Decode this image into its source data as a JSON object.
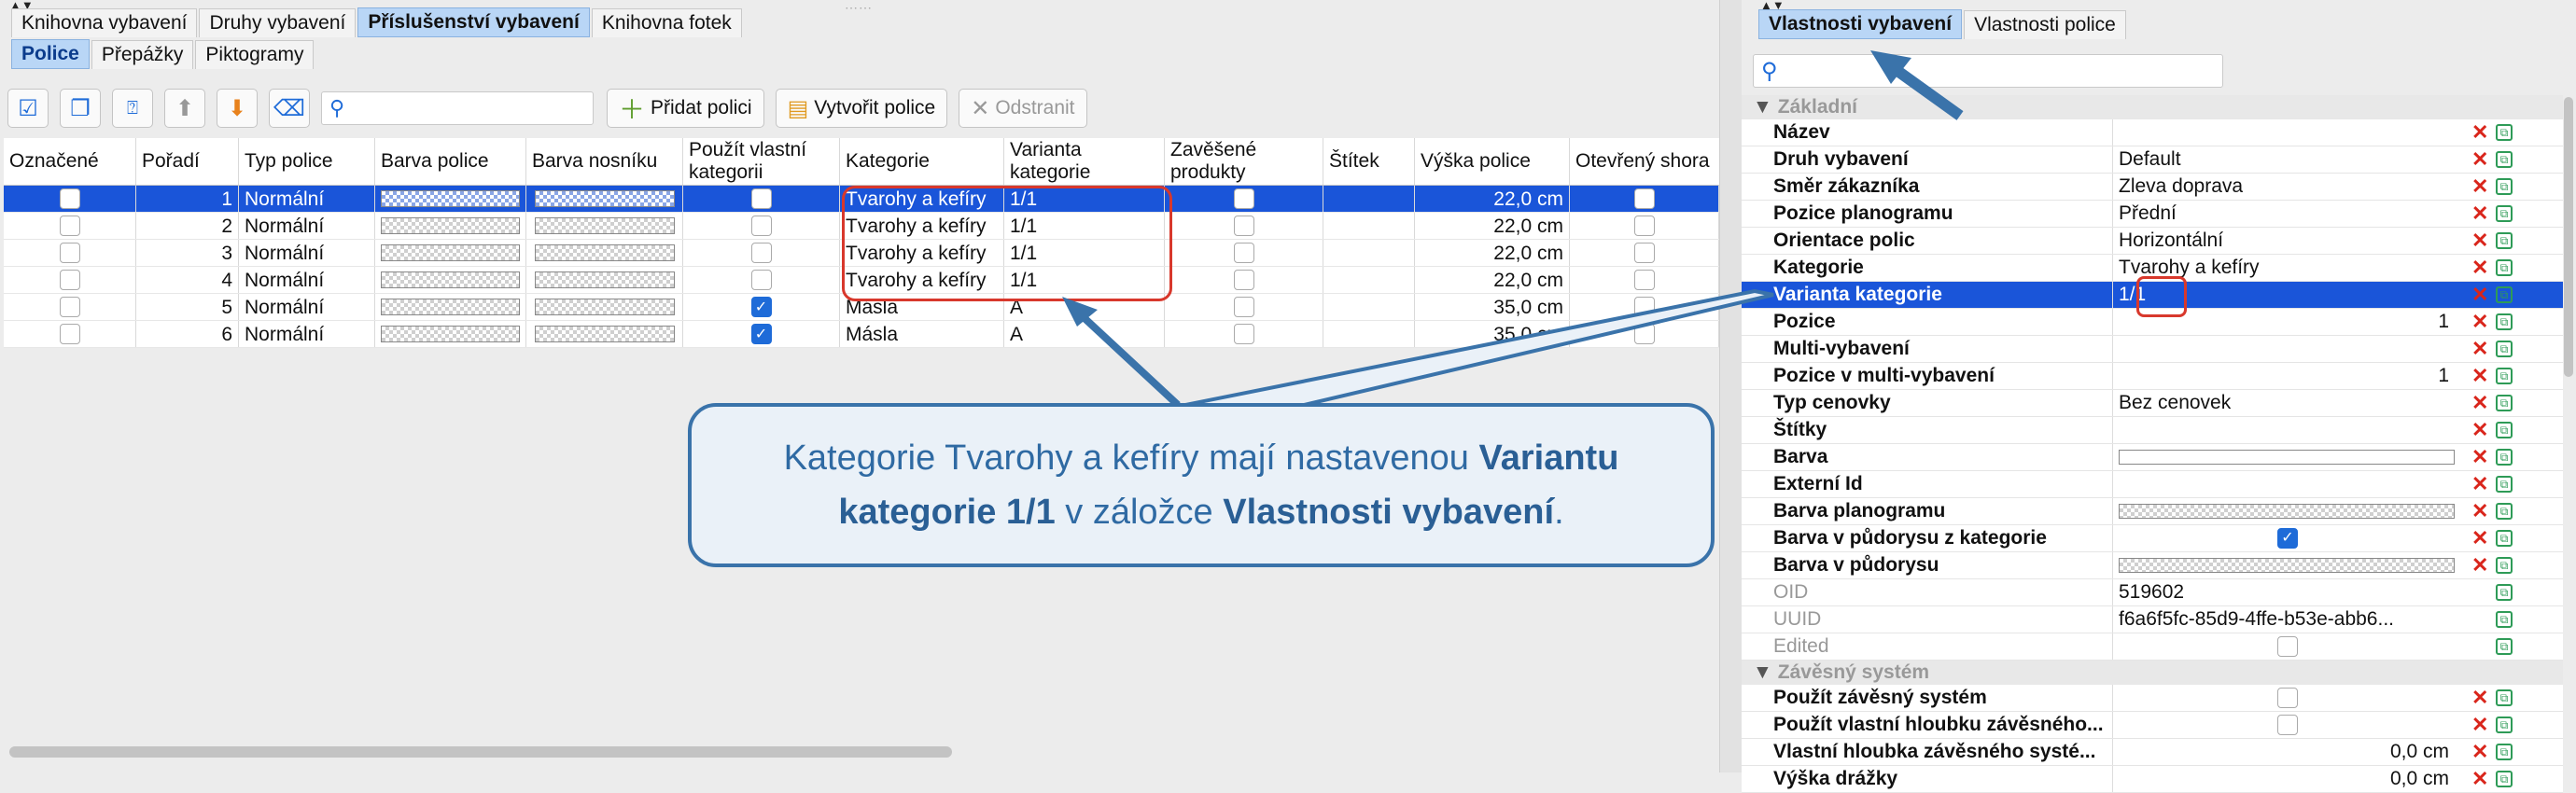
{
  "main_tabs": [
    "Knihovna vybavení",
    "Druhy vybavení",
    "Příslušenství vybavení",
    "Knihovna fotek"
  ],
  "sub_tabs": [
    "Police",
    "Přepážky",
    "Piktogramy"
  ],
  "toolbar": {
    "add_shelf": "Přidat polici",
    "create_shelves": "Vytvořit police",
    "remove": "Odstranit"
  },
  "table": {
    "columns": [
      "Označené",
      "Pořadí",
      "Typ police",
      "Barva police",
      "Barva nosníku",
      "Použít vlastní kategorii",
      "Kategorie",
      "Varianta kategorie",
      "Zavěšené produkty",
      "Štítek",
      "Výška police",
      "Otevřený shora"
    ],
    "rows": [
      {
        "order": "1",
        "type": "Normální",
        "own_cat": false,
        "category": "Tvarohy a kefíry",
        "variant": "1/1",
        "label": "",
        "height": "22,0 cm"
      },
      {
        "order": "2",
        "type": "Normální",
        "own_cat": false,
        "category": "Tvarohy a kefíry",
        "variant": "1/1",
        "label": "",
        "height": "22,0 cm"
      },
      {
        "order": "3",
        "type": "Normální",
        "own_cat": false,
        "category": "Tvarohy a kefíry",
        "variant": "1/1",
        "label": "",
        "height": "22,0 cm"
      },
      {
        "order": "4",
        "type": "Normální",
        "own_cat": false,
        "category": "Tvarohy a kefíry",
        "variant": "1/1",
        "label": "",
        "height": "22,0 cm"
      },
      {
        "order": "5",
        "type": "Normální",
        "own_cat": true,
        "category": "Másla",
        "variant": "A",
        "label": "",
        "height": "35,0 cm"
      },
      {
        "order": "6",
        "type": "Normální",
        "own_cat": true,
        "category": "Másla",
        "variant": "A",
        "label": "",
        "height": "35,0 cm"
      }
    ]
  },
  "callout": {
    "t1": "Kategorie Tvarohy a kefíry mají nastavenou ",
    "b1": "Variantu kategorie 1/1",
    "t2": " v záložce ",
    "b2": "Vlastnosti vybavení",
    "t3": "."
  },
  "right_tabs": [
    "Vlastnosti vybavení",
    "Vlastnosti police"
  ],
  "props": {
    "section_basic": "Základní",
    "section_hanging": "Závěsný systém",
    "rows": [
      {
        "name": "Název",
        "value": ""
      },
      {
        "name": "Druh vybavení",
        "value": "Default"
      },
      {
        "name": "Směr zákazníka",
        "value": "Zleva doprava"
      },
      {
        "name": "Pozice planogramu",
        "value": "Přední"
      },
      {
        "name": "Orientace polic",
        "value": "Horizontální"
      },
      {
        "name": "Kategorie",
        "value": "Tvarohy a kefíry"
      },
      {
        "name": "Varianta kategorie",
        "value": "1/1"
      },
      {
        "name": "Pozice",
        "value": "1"
      },
      {
        "name": "Multi-vybavení",
        "value": ""
      },
      {
        "name": "Pozice v multi-vybavení",
        "value": "1"
      },
      {
        "name": "Typ cenovky",
        "value": "Bez cenovek"
      },
      {
        "name": "Štítky",
        "value": ""
      },
      {
        "name": "Barva",
        "value": ""
      },
      {
        "name": "Externí Id",
        "value": ""
      },
      {
        "name": "Barva planogramu",
        "value": ""
      },
      {
        "name": "Barva v půdorysu z kategorie",
        "value": ""
      },
      {
        "name": "Barva v půdorysu",
        "value": ""
      },
      {
        "name": "OID",
        "value": "519602"
      },
      {
        "name": "UUID",
        "value": "f6a6f5fc-85d9-4ffe-b53e-abb6..."
      },
      {
        "name": "Edited",
        "value": ""
      }
    ],
    "hanging_rows": [
      {
        "name": "Použít závěsný systém",
        "value": ""
      },
      {
        "name": "Použít vlastní hloubku závěsného...",
        "value": ""
      },
      {
        "name": "Vlastní hloubka závěsného systé...",
        "value": "0,0 cm"
      },
      {
        "name": "Výška drážky",
        "value": "0,0 cm"
      }
    ]
  },
  "colors": {
    "selection": "#1a55d9",
    "callout_border": "#3a73aa",
    "callout_text": "#2f6aa3",
    "highlight_red": "#d8382c"
  },
  "icons": [
    "search-icon",
    "check-all-icon",
    "copy-icon",
    "help-icon",
    "arrow-up-icon",
    "arrow-down-icon",
    "delete-list-icon",
    "plus-icon",
    "shelves-icon",
    "close-icon"
  ]
}
